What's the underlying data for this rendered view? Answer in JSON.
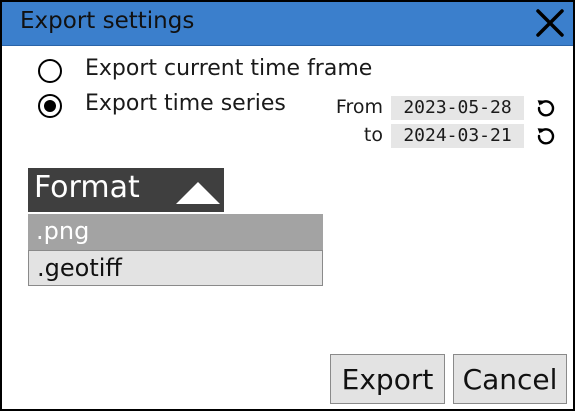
{
  "window": {
    "title": "Export settings"
  },
  "export_mode": {
    "options": [
      {
        "label": "Export current time frame",
        "checked": false
      },
      {
        "label": "Export time series",
        "checked": true
      }
    ]
  },
  "time_range": {
    "from_label": "From",
    "from_value": "2023-05-28",
    "to_label": "to",
    "to_value": "2024-03-21"
  },
  "format": {
    "header_label": "Format",
    "options": [
      ".png",
      ".geotiff"
    ],
    "selected": ".png"
  },
  "buttons": {
    "export": "Export",
    "cancel": "Cancel"
  },
  "colors": {
    "titlebar": "#3b7fcc",
    "format_header": "#3f3f3f",
    "selected_option": "#a3a3a3",
    "button_bg": "#e3e3e3",
    "date_field_bg": "#e6e6e6"
  }
}
